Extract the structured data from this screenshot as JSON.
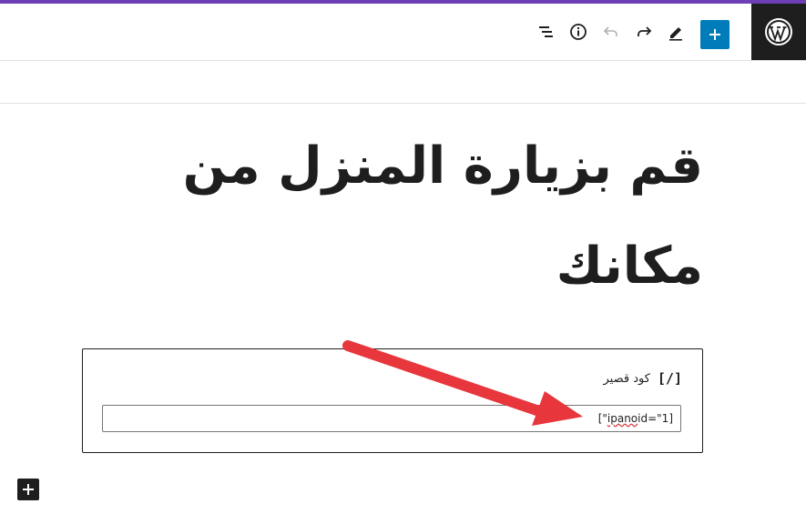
{
  "header": {
    "accent_color": "#6c3fb5",
    "tools": [
      "list-view-icon",
      "info-icon",
      "undo-icon",
      "redo-icon",
      "edit-pencil-icon"
    ],
    "add_block_color": "#007cba",
    "logo": "wordpress-logo"
  },
  "post": {
    "title": "قم بزيارة المنزل من مكانك"
  },
  "shortcode_block": {
    "icon": "[/]",
    "label": "كود قصير",
    "value_prefix": "[\"",
    "value_misspelled": "ipano",
    "value_suffix": " id=\"1]"
  },
  "annotation": {
    "arrow_color": "#e8363d"
  }
}
